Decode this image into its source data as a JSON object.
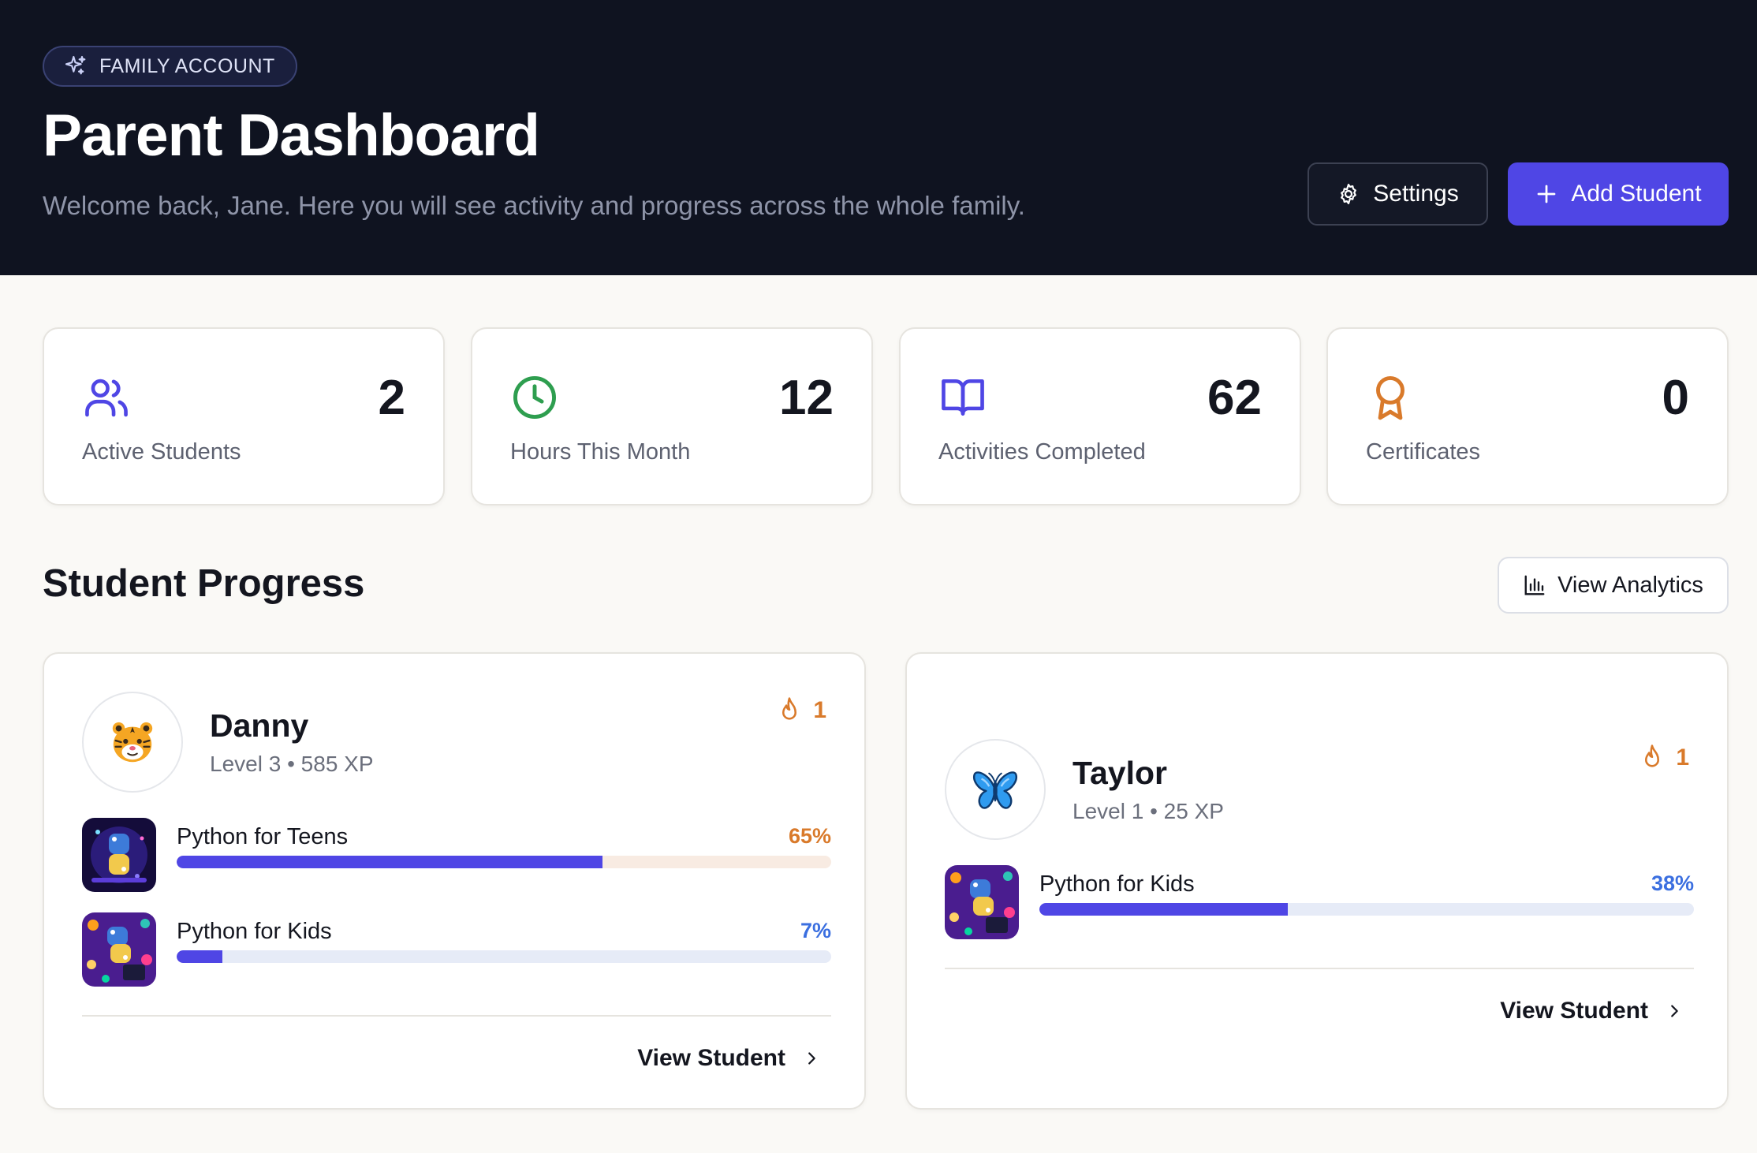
{
  "header": {
    "badge": "FAMILY ACCOUNT",
    "title": "Parent Dashboard",
    "subtitle": "Welcome back, Jane. Here you will see activity and progress across the whole family.",
    "settings_label": "Settings",
    "add_student_label": "Add Student"
  },
  "stats": [
    {
      "value": "2",
      "label": "Active Students",
      "icon": "users-icon",
      "color": "#4f46e5"
    },
    {
      "value": "12",
      "label": "Hours This Month",
      "icon": "clock-icon",
      "color": "#2e9e4f"
    },
    {
      "value": "62",
      "label": "Activities Completed",
      "icon": "book-icon",
      "color": "#4f46e5"
    },
    {
      "value": "0",
      "label": "Certificates",
      "icon": "award-icon",
      "color": "#d97a2b"
    }
  ],
  "progress": {
    "title": "Student Progress",
    "analytics_label": "View Analytics"
  },
  "students": [
    {
      "name": "Danny",
      "level": "Level 3",
      "xp": "585 XP",
      "streak": "1",
      "avatar": "tiger-icon",
      "view_label": "View Student",
      "courses": [
        {
          "name": "Python for Teens",
          "percent_label": "65%",
          "progress": 0.65,
          "pct_color": "#d97a2b",
          "track_color": "#f8ebe2"
        },
        {
          "name": "Python for Kids",
          "percent_label": "7%",
          "progress": 0.07,
          "pct_color": "#3b6fe0",
          "track_color": "#e6ebf7"
        }
      ]
    },
    {
      "name": "Taylor",
      "level": "Level 1",
      "xp": "25 XP",
      "streak": "1",
      "avatar": "butterfly-icon",
      "view_label": "View Student",
      "courses": [
        {
          "name": "Python for Kids",
          "percent_label": "38%",
          "progress": 0.38,
          "pct_color": "#3b6fe0",
          "track_color": "#e6ebf7"
        }
      ]
    }
  ]
}
